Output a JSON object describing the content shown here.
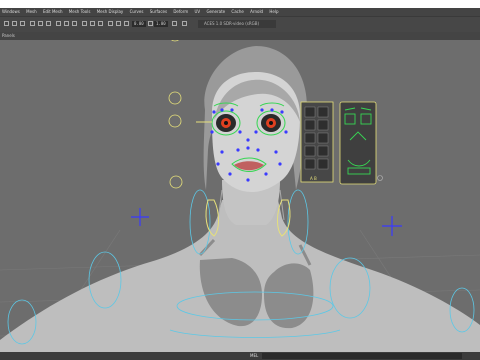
{
  "menus": [
    "Windows",
    "Mesh",
    "Edit Mesh",
    "Mesh Tools",
    "Mesh Display",
    "Curves",
    "Surfaces",
    "Deform",
    "UV",
    "Generate",
    "Cache",
    "Arnold",
    "Help"
  ],
  "toolbar": {
    "field1": "0.00",
    "field2": "1.00",
    "camera_label": "ACES 1.0 SDR-video (sRGB)"
  },
  "panel_menu": "Panels",
  "status": {
    "label": "MEL"
  },
  "rig_panel": {
    "label": "A  B"
  },
  "colors": {
    "viewport": "#6d6d6d",
    "control_green": "#37d653",
    "control_blue": "#3a3aff",
    "control_yellow": "#e6e07a",
    "control_cyan": "#5cc8e6"
  }
}
